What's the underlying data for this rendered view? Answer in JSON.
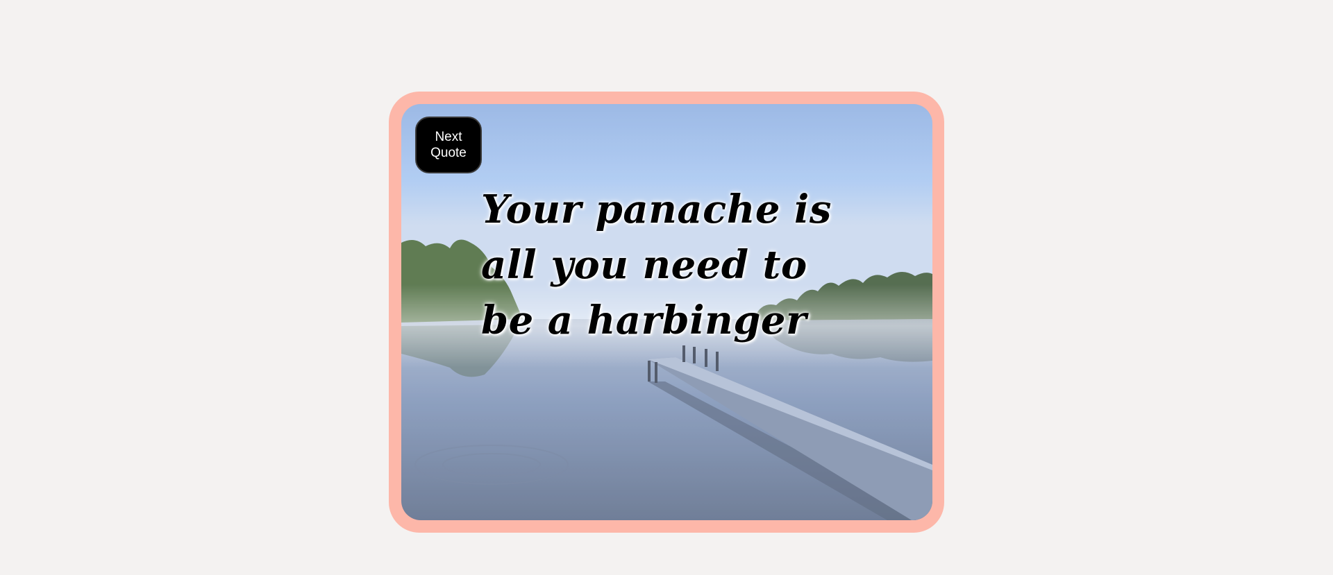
{
  "colors": {
    "page_background": "#f4f2f1",
    "frame_border": "#fdb7a9",
    "button_background": "#000000",
    "button_text": "#ffffff",
    "quote_text": "#000000"
  },
  "next_quote_button": {
    "label": "Next Quote"
  },
  "quote": {
    "text": "Your panache is all you need to be a harbinger"
  },
  "background_image": {
    "icon": "lake-pier-scene"
  }
}
